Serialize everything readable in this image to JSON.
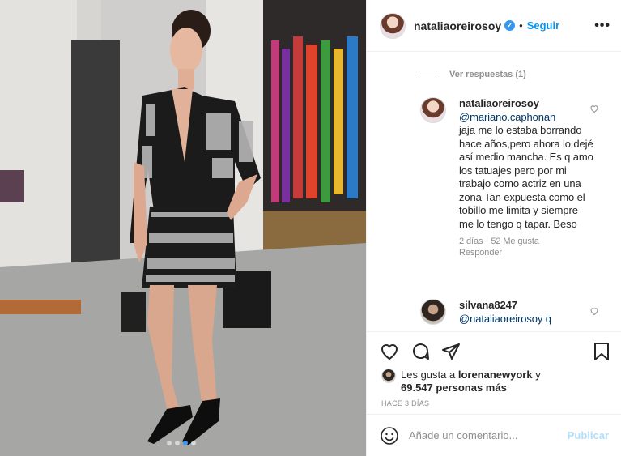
{
  "post": {
    "username": "nataliaoreirosoy",
    "separator": "•",
    "follow_label": "Seguir",
    "more_label": "•••",
    "verified_mark": "✓"
  },
  "comments": {
    "view_replies": "Ver respuestas (1)",
    "items": [
      {
        "username": "nataliaoreirosoy",
        "mention": "@mariano.caphonan",
        "text": "jaja me lo estaba borrando hace años,pero ahora lo dejé así medio mancha. Es q amo los tatuajes pero por mi trabajo como actriz en una zona Tan expuesta como el tobillo me limita y siempre me lo tengo q tapar. Beso",
        "time": "2 días",
        "likes": "52 Me gusta",
        "reply": "Responder"
      },
      {
        "username": "silvana8247",
        "mention": "@nataliaoreirosoy q",
        "text": ""
      }
    ]
  },
  "likes": {
    "prefix": "Les gusta a",
    "user": "lorenanewyork",
    "joiner": "y",
    "count": "69.547 personas más"
  },
  "date": "HACE 3 DÍAS",
  "add_comment": {
    "placeholder": "Añade un comentario...",
    "post_label": "Publicar"
  },
  "carousel": {
    "count": 4,
    "active": 3
  },
  "colors": {
    "accent": "#0095f6",
    "muted": "#8e8e8e",
    "mention": "#00376b"
  },
  "icons": [
    "heart-icon",
    "comment-icon",
    "share-icon",
    "bookmark-icon",
    "emoji-icon"
  ]
}
